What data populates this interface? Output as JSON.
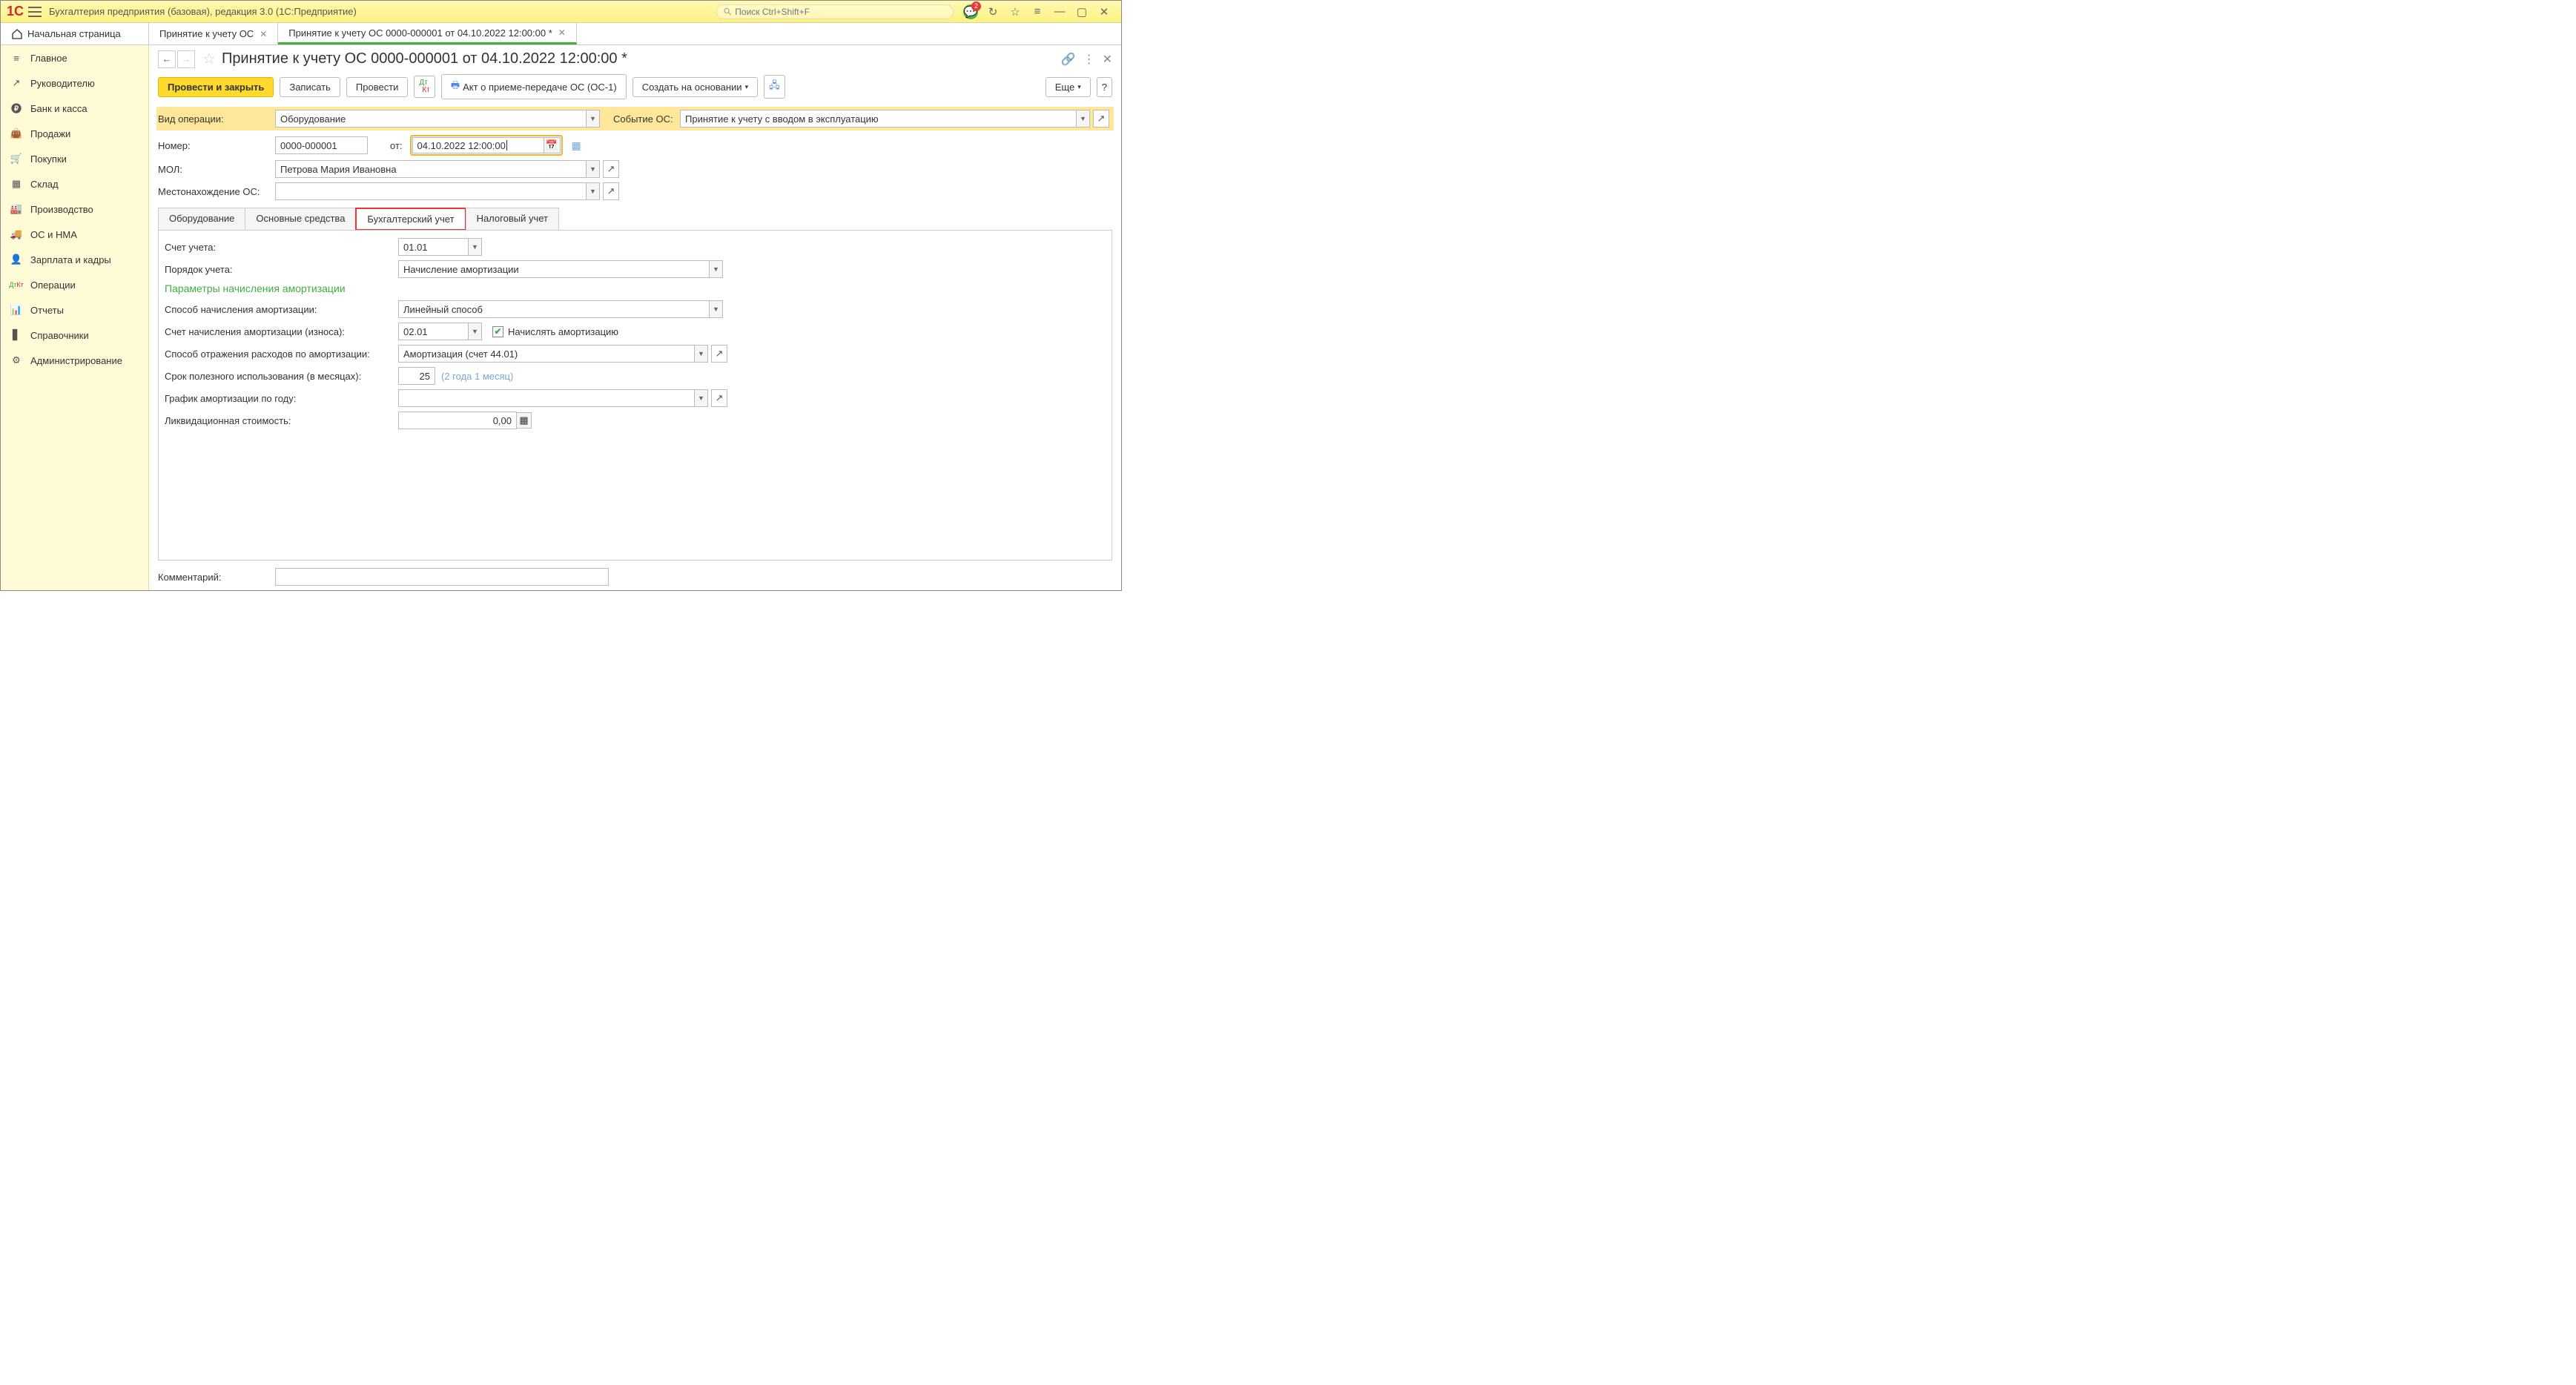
{
  "titlebar": {
    "app_title": "Бухгалтерия предприятия (базовая), редакция 3.0  (1С:Предприятие)",
    "search_placeholder": "Поиск Ctrl+Shift+F",
    "badge": "2"
  },
  "tabs": {
    "home": "Начальная страница",
    "t1": "Принятие к учету ОС",
    "t2": "Принятие к учету ОС 0000-000001 от 04.10.2022 12:00:00 *"
  },
  "sidebar": [
    {
      "icon": "≡",
      "label": "Главное"
    },
    {
      "icon": "↗",
      "label": "Руководителю"
    },
    {
      "icon": "₽",
      "label": "Банк и касса"
    },
    {
      "icon": "👜",
      "label": "Продажи"
    },
    {
      "icon": "🛒",
      "label": "Покупки"
    },
    {
      "icon": "▦",
      "label": "Склад"
    },
    {
      "icon": "🏭",
      "label": "Производство"
    },
    {
      "icon": "🚚",
      "label": "ОС и НМА"
    },
    {
      "icon": "👤",
      "label": "Зарплата и кадры"
    },
    {
      "icon": "Дт",
      "label": "Операции"
    },
    {
      "icon": "📊",
      "label": "Отчеты"
    },
    {
      "icon": "📕",
      "label": "Справочники"
    },
    {
      "icon": "⚙",
      "label": "Администрирование"
    }
  ],
  "page": {
    "title": "Принятие к учету ОС 0000-000001 от 04.10.2022 12:00:00 *",
    "btn_post_close": "Провести и закрыть",
    "btn_write": "Записать",
    "btn_post": "Провести",
    "btn_act": "Акт о приеме-передаче ОС (ОС-1)",
    "btn_create_based": "Создать на основании",
    "btn_more": "Еще",
    "lbl_optype": "Вид операции:",
    "val_optype": "Оборудование",
    "lbl_event": "Событие ОС:",
    "val_event": "Принятие к учету с вводом в эксплуатацию",
    "lbl_number": "Номер:",
    "val_number": "0000-000001",
    "lbl_from": "от:",
    "val_date": "04.10.2022 12:00:00",
    "lbl_mol": "МОЛ:",
    "val_mol": "Петрова Мария Ивановна",
    "lbl_location": "Местонахождение ОС:",
    "val_location": "",
    "inner_tabs": [
      "Оборудование",
      "Основные средства",
      "Бухгалтерский учет",
      "Налоговый учет"
    ],
    "lbl_account": "Счет учета:",
    "val_account": "01.01",
    "lbl_order": "Порядок учета:",
    "val_order": "Начисление амортизации",
    "section": "Параметры начисления амортизации",
    "lbl_method": "Способ начисления амортизации:",
    "val_method": "Линейный способ",
    "lbl_dep_account": "Счет начисления амортизации (износа):",
    "val_dep_account": "02.01",
    "chk_label": "Начислять амортизацию",
    "lbl_reflect": "Способ отражения расходов по амортизации:",
    "val_reflect": "Амортизация (счет 44.01)",
    "lbl_useful": "Срок полезного использования (в месяцах):",
    "val_useful": "25",
    "hint_useful": "(2 года 1 месяц)",
    "lbl_schedule": "График амортизации по году:",
    "lbl_liquid": "Ликвидационная стоимость:",
    "val_liquid": "0,00",
    "lbl_comment": "Комментарий:"
  }
}
